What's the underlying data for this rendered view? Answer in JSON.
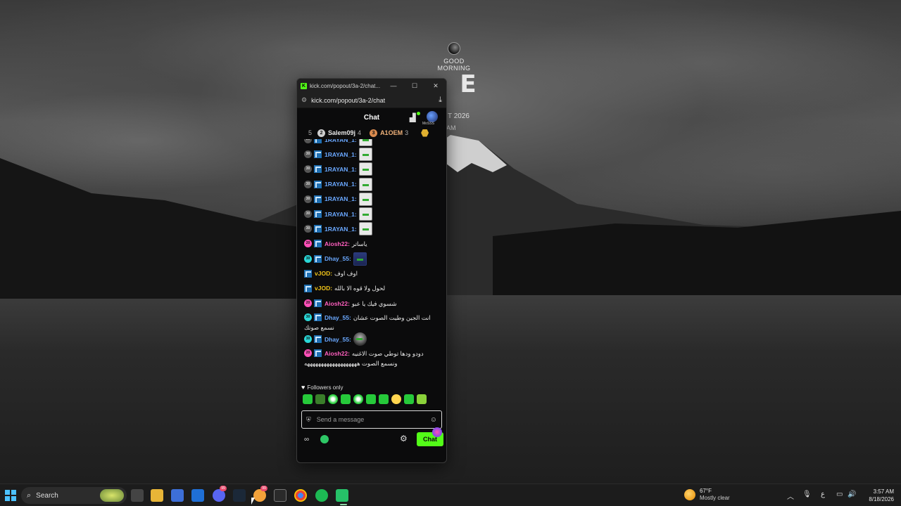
{
  "desktop": {
    "widget": {
      "greeting_line1": "GOOD",
      "greeting_line2": "MORNING",
      "big_letter": "E",
      "date_text": "T 2026",
      "ampm": "AM"
    }
  },
  "window": {
    "title": "kick.com/popout/3a-2/chat...",
    "controls": {
      "minimize": "—",
      "maximize": "☐",
      "close": "✕"
    },
    "url": "kick.com/popout/3a-2/chat"
  },
  "chat": {
    "header_title": "Chat",
    "avatar_label": "MoSSS",
    "leaderboard": {
      "rank_number": "5",
      "entries": [
        {
          "badge": "2",
          "name": "Salem09j",
          "count": "4",
          "color": "#e6e6e6",
          "badge_color": "#cfcfcf"
        },
        {
          "badge": "3",
          "name": "A1OEM",
          "count": "3",
          "color": "#f0b27a",
          "badge_color": "#d98a4e"
        }
      ],
      "extra_badge": "1"
    },
    "messages": [
      {
        "sub": "30",
        "subcolor": "gray",
        "user": "1RAYAN_1:",
        "usercolor": "#6aa8ff",
        "emote": "light",
        "text": ""
      },
      {
        "sub": "30",
        "subcolor": "gray",
        "user": "1RAYAN_1:",
        "usercolor": "#6aa8ff",
        "emote": "light",
        "text": ""
      },
      {
        "sub": "30",
        "subcolor": "gray",
        "user": "1RAYAN_1:",
        "usercolor": "#6aa8ff",
        "emote": "light",
        "text": ""
      },
      {
        "sub": "30",
        "subcolor": "gray",
        "user": "1RAYAN_1:",
        "usercolor": "#6aa8ff",
        "emote": "light",
        "text": ""
      },
      {
        "sub": "30",
        "subcolor": "gray",
        "user": "1RAYAN_1:",
        "usercolor": "#6aa8ff",
        "emote": "light",
        "text": ""
      },
      {
        "sub": "30",
        "subcolor": "gray",
        "user": "1RAYAN_1:",
        "usercolor": "#6aa8ff",
        "emote": "light",
        "text": ""
      },
      {
        "sub": "30",
        "subcolor": "gray",
        "user": "1RAYAN_1:",
        "usercolor": "#6aa8ff",
        "emote": "light",
        "text": ""
      },
      {
        "sub": "20",
        "subcolor": "pink",
        "user": "Aiosh22:",
        "usercolor": "#ff5fbf",
        "emote": "",
        "text": "ياساتر"
      },
      {
        "sub": "30",
        "subcolor": "cyan",
        "user": "Dhay_55:",
        "usercolor": "#6aa8ff",
        "emote": "dark",
        "text": ""
      },
      {
        "sub": "",
        "subcolor": "",
        "user": "vJOD:",
        "usercolor": "#f0c419",
        "emote": "",
        "text": "اوف اوف"
      },
      {
        "sub": "",
        "subcolor": "",
        "user": "vJOD:",
        "usercolor": "#f0c419",
        "emote": "",
        "text": "لحول ولا قوه الا بالله"
      },
      {
        "sub": "20",
        "subcolor": "pink",
        "user": "Aiosh22:",
        "usercolor": "#ff5fbf",
        "emote": "",
        "text": "شسوي فيك يا عبو"
      },
      {
        "sub": "30",
        "subcolor": "cyan",
        "user": "Dhay_55:",
        "usercolor": "#6aa8ff",
        "emote": "",
        "text": "انت الجين وطيت الصوت عشان",
        "text2": "نسمع صوتك"
      },
      {
        "sub": "30",
        "subcolor": "cyan",
        "user": "Dhay_55:",
        "usercolor": "#6aa8ff",
        "emote": "round",
        "text": ""
      },
      {
        "sub": "20",
        "subcolor": "pink",
        "user": "Aiosh22:",
        "usercolor": "#ff5fbf",
        "emote": "",
        "text": "دودو ودها توطي صوت الاغنيه",
        "text2": "ونسمع الصوت هههههههههههههههههههه"
      }
    ],
    "followers_only": "Followers only",
    "input_placeholder": "Send a message",
    "chat_button": "Chat",
    "points_icon": "∞"
  },
  "taskbar": {
    "search_label": "Search",
    "weather_temp": "67°F",
    "weather_desc": "Mostly clear",
    "tray_lang": "ع",
    "time": "3:57 AM",
    "date": "8/18/2026",
    "badges": {
      "discord": "99",
      "steam": "99"
    }
  }
}
